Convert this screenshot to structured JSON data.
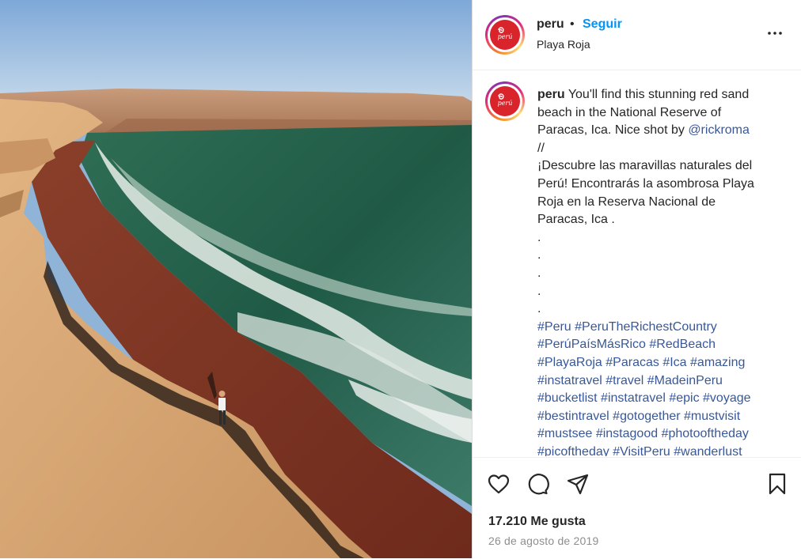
{
  "post": {
    "image_alt": "Red sand beach at the National Reserve of Paracas",
    "author": {
      "username": "peru",
      "avatar_text": "perú",
      "separator": "•",
      "follow_label": "Seguir",
      "location": "Playa Roja"
    },
    "caption": {
      "username": "peru",
      "lines": [
        "You'll find this stunning red sand",
        "beach in the National Reserve of",
        "Paracas, Ica. Nice shot by ",
        "//",
        "¡Descubre las maravillas naturales del",
        "Perú! Encontrarás la asombrosa Playa",
        "Roja en la Reserva Nacional de",
        "Paracas, Ica .",
        ".",
        ".",
        ".",
        ".",
        "."
      ],
      "mention": "@rickroma",
      "hashtag_lines": [
        [
          "#Peru",
          "#PeruTheRichestCountry"
        ],
        [
          "#PerúPaísMásRico",
          "#RedBeach"
        ],
        [
          "#PlayaRoja",
          "#Paracas",
          "#Ica",
          "#amazing"
        ],
        [
          "#instatravel",
          "#travel",
          "#MadeinPeru"
        ],
        [
          "#bucketlist",
          "#instatravel",
          "#epic",
          "#voyage"
        ],
        [
          "#bestintravel",
          "#gotogether",
          "#mustvisit"
        ],
        [
          "#mustsee",
          "#instagood",
          "#photooftheday"
        ],
        [
          "#picoftheday",
          "#VisitPeru",
          "#wanderlust"
        ]
      ]
    },
    "actions": {
      "like_icon": "heart-icon",
      "comment_icon": "comment-icon",
      "share_icon": "paper-plane-icon",
      "save_icon": "bookmark-icon",
      "more_icon": "more-dots-icon"
    },
    "likes_text": "17.210 Me gusta",
    "date_text": "26 de agosto de 2019"
  },
  "colors": {
    "link": "#0095f6",
    "hashtag": "#385898",
    "muted": "#8e8e8e",
    "brand_red": "#d9242b"
  }
}
